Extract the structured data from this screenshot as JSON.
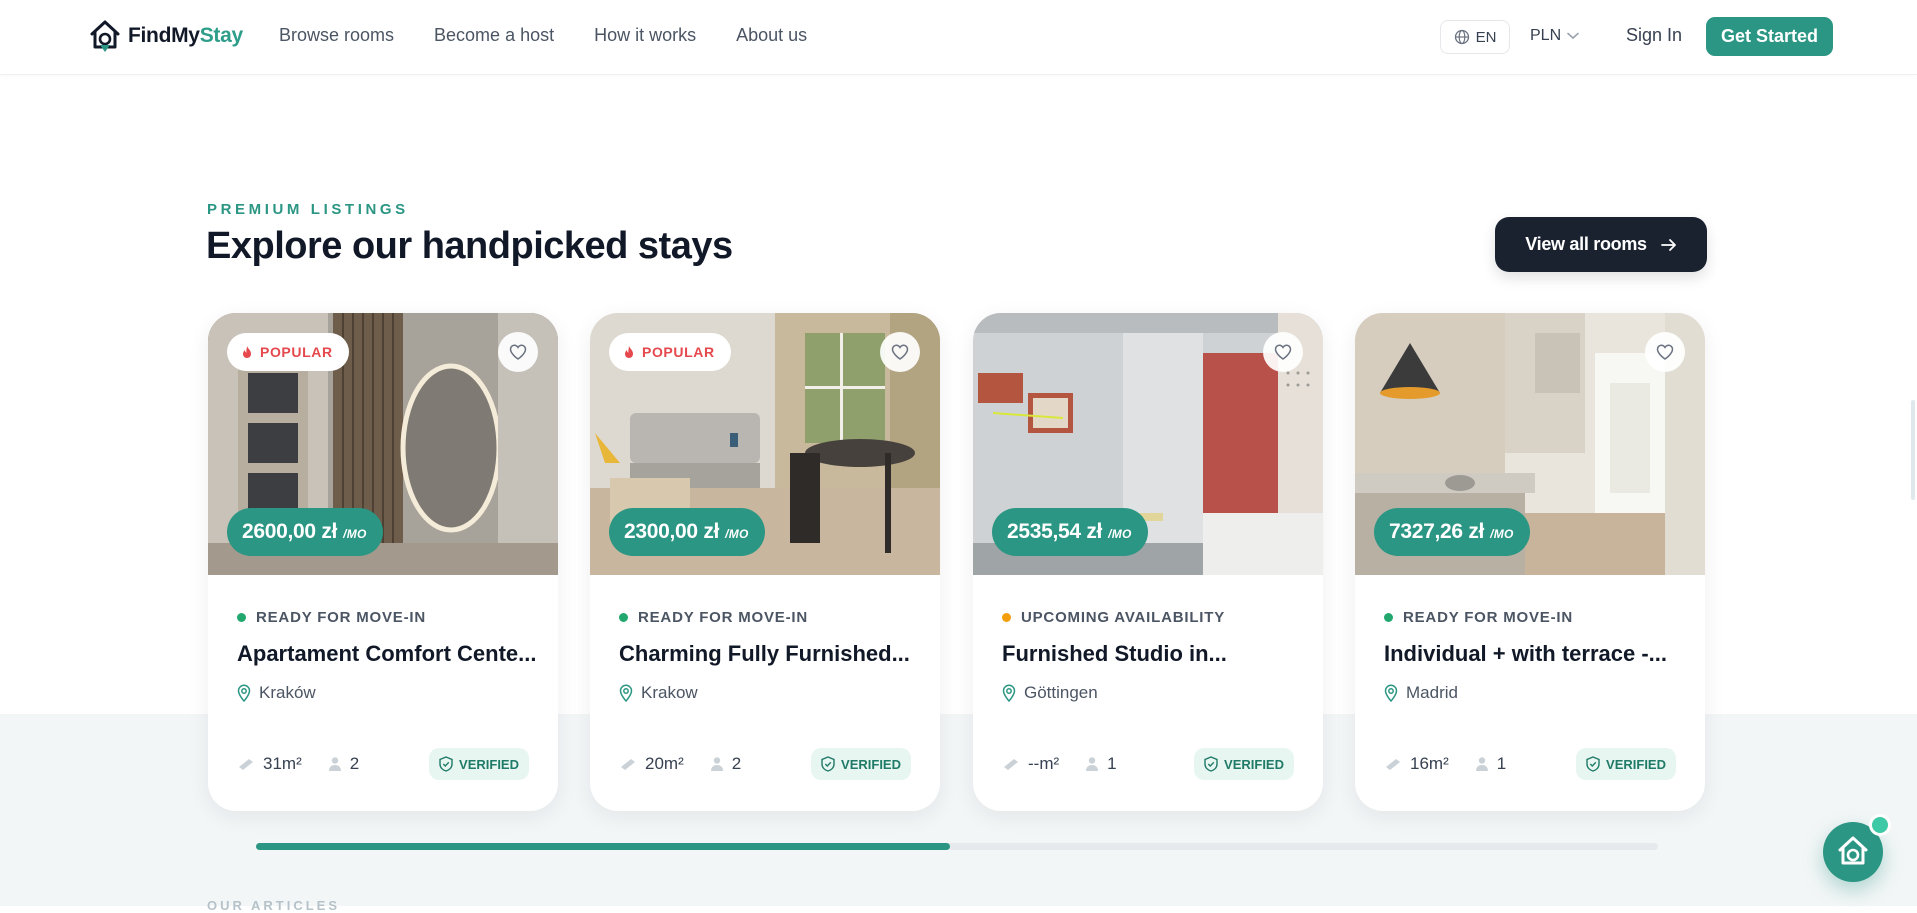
{
  "nav": {
    "brand_a": "FindMy",
    "brand_b": "Stay",
    "links": [
      "Browse rooms",
      "Become a host",
      "How it works",
      "About us"
    ],
    "lang": "EN",
    "currency": "PLN",
    "sign_in": "Sign In",
    "get_started": "Get Started"
  },
  "section": {
    "eyebrow": "PREMIUM LISTINGS",
    "heading": "Explore our handpicked stays",
    "view_all": "View all rooms",
    "next_label": "OUR ARTICLES"
  },
  "colors": {
    "accent": "#2a9683",
    "popular": "#e5484d",
    "ready": "#22a86f",
    "upcoming": "#f59e0b",
    "dark": "#1a2230"
  },
  "cards": [
    {
      "popular": "POPULAR",
      "price": "2600,00 zł",
      "per": "/MO",
      "status": "READY FOR MOVE-IN",
      "status_color": "#22a86f",
      "title": "Apartament Comfort Cente...",
      "location": "Kraków",
      "area": "31m²",
      "guests": "2",
      "verified": "VERIFIED"
    },
    {
      "popular": "POPULAR",
      "price": "2300,00 zł",
      "per": "/MO",
      "status": "READY FOR MOVE-IN",
      "status_color": "#22a86f",
      "title": "Charming Fully Furnished...",
      "location": "Krakow",
      "area": "20m²",
      "guests": "2",
      "verified": "VERIFIED"
    },
    {
      "popular": "",
      "price": "2535,54 zł",
      "per": "/MO",
      "status": "UPCOMING AVAILABILITY",
      "status_color": "#f59e0b",
      "title": "Furnished Studio in...",
      "location": "Göttingen",
      "area": "--m²",
      "guests": "1",
      "verified": "VERIFIED"
    },
    {
      "popular": "",
      "price": "7327,26 zł",
      "per": "/MO",
      "status": "READY FOR MOVE-IN",
      "status_color": "#22a86f",
      "title": "Individual + with terrace -...",
      "location": "Madrid",
      "area": "16m²",
      "guests": "1",
      "verified": "VERIFIED"
    }
  ],
  "carousel": {
    "progress": 0.495
  },
  "icons": {
    "lang": "globe-icon",
    "currency": "chevron-down-icon",
    "view_all": "arrow-right-icon",
    "popular": "flame-icon",
    "favorite": "heart-icon",
    "location": "map-pin-icon",
    "area": "ruler-icon",
    "guests": "user-icon",
    "verified": "shield-check-icon",
    "chat": "support-chat-icon"
  }
}
